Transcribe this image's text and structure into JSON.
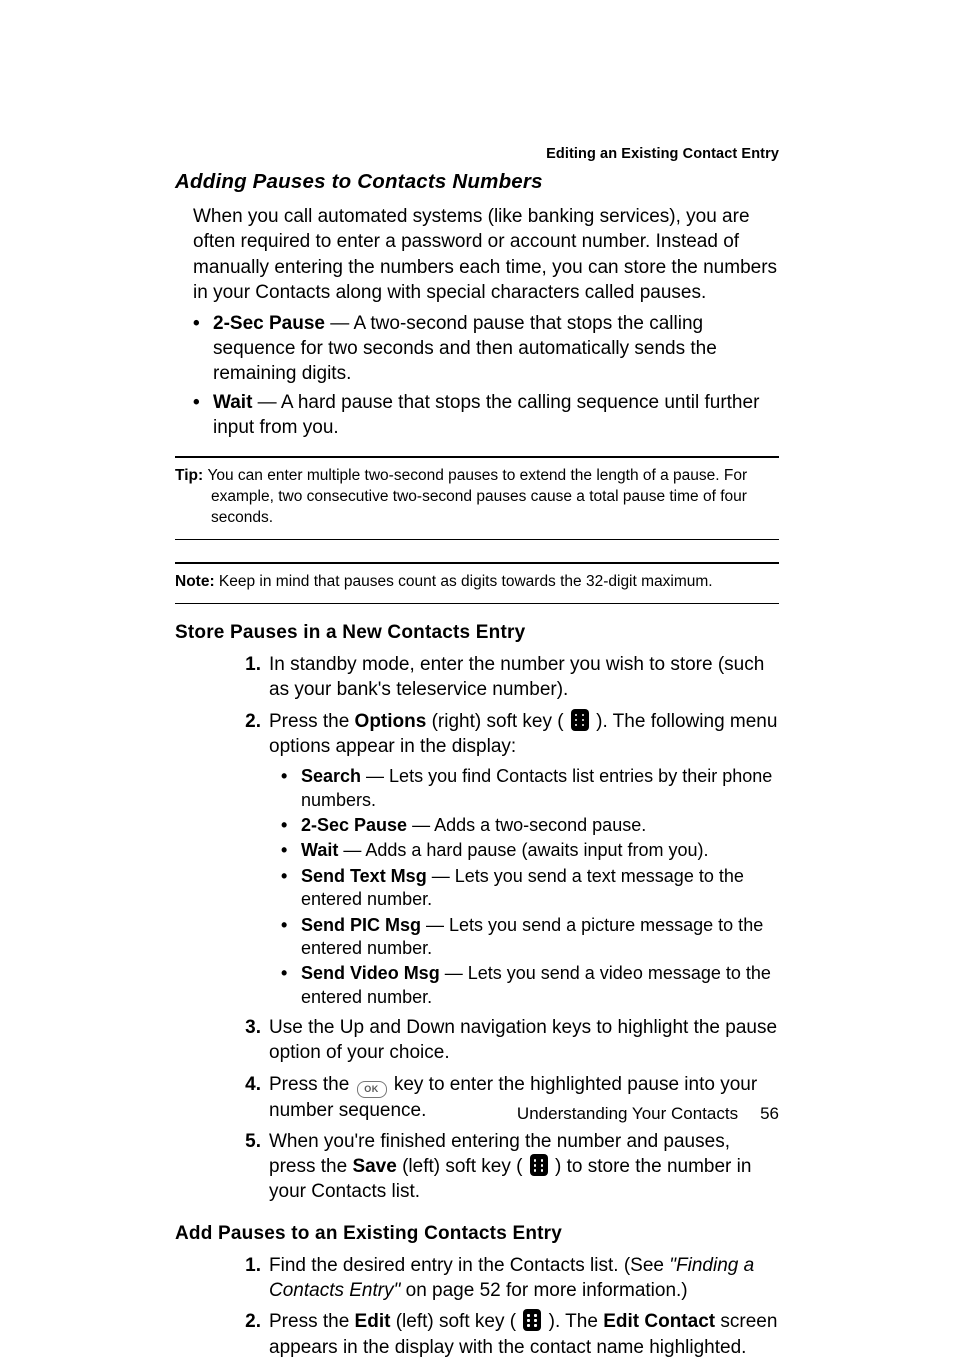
{
  "runningHead": "Editing an Existing Contact Entry",
  "h2": "Adding Pauses to Contacts Numbers",
  "intro": "When you call automated systems (like banking services), you are often required to enter a password or account number. Instead of manually entering the numbers each time, you can store the numbers in your Contacts along with special characters called pauses.",
  "pauseBullets": {
    "b1_label": "2-Sec Pause",
    "b1_rest": " — A two-second pause that stops the calling sequence for two seconds and then automatically sends the remaining digits.",
    "b2_label": "Wait",
    "b2_rest": " — A hard pause that stops the calling sequence until further input from you."
  },
  "tip": {
    "label": "Tip: ",
    "text": "You can enter multiple two-second pauses to extend the length of a pause. For example, two consecutive two-second pauses cause a total pause time of four seconds."
  },
  "note": {
    "label": "Note: ",
    "text": "Keep in mind that pauses count as digits towards the 32-digit maximum."
  },
  "h3a": "Store Pauses in a New Contacts Entry",
  "stepsA": {
    "s1": "In standby mode, enter the number you wish to store (such as your bank's teleservice number).",
    "s2_pre": "Press the ",
    "s2_b1": "Options",
    "s2_mid1": " (right) soft key ( ",
    "s2_mid2": " ). The following menu options appear in the display:",
    "sub": {
      "a_label": "Search",
      "a_rest": " — Lets you find Contacts list entries by their phone numbers.",
      "b_label": "2-Sec Pause",
      "b_rest": " — Adds a two-second pause.",
      "c_label": "Wait",
      "c_rest": " — Adds a hard pause (awaits input from you).",
      "d_label": "Send Text Msg",
      "d_rest": " — Lets you send a text message to the entered number.",
      "e_label": "Send PIC Msg",
      "e_rest": " — Lets you send a picture message to the entered number.",
      "f_label": "Send Video Msg",
      "f_rest": " — Lets you send a video message to the entered number."
    },
    "s3": "Use the Up and Down navigation keys to highlight the pause option of your choice.",
    "s4_pre": "Press the ",
    "s4_post": " key to enter the highlighted pause into your number sequence.",
    "s5_pre": "When you're finished entering the number and pauses, press the ",
    "s5_b1": "Save",
    "s5_mid": " (left) soft key ( ",
    "s5_post": " ) to store the number in your Contacts list."
  },
  "h3b": "Add Pauses to an Existing Contacts Entry",
  "stepsB": {
    "s1_pre": "Find the desired entry in the Contacts list. (See ",
    "s1_ref": "\"Finding a Contacts Entry\"",
    "s1_post": " on page 52 for more information.)",
    "s2_pre": "Press the ",
    "s2_b1": "Edit",
    "s2_mid1": " (left) soft key ( ",
    "s2_mid2": " ). The ",
    "s2_b2": "Edit Contact",
    "s2_post": " screen appears in the display with the contact name highlighted."
  },
  "footer": {
    "section": "Understanding Your Contacts",
    "page": "56"
  },
  "okLabel": "OK"
}
